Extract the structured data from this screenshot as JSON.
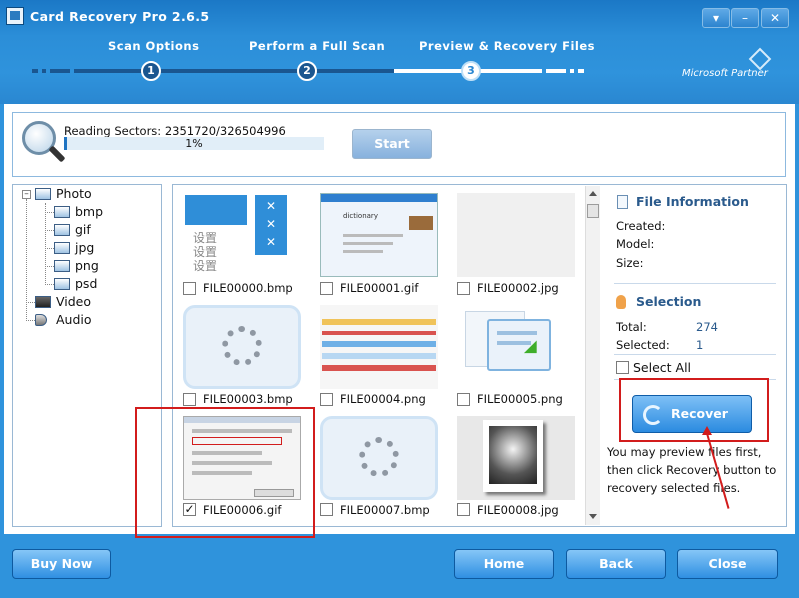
{
  "window": {
    "title": "Card Recovery Pro 2.6.5",
    "menu_glyph": "▾",
    "minimize_glyph": "–",
    "close_glyph": "✕"
  },
  "steps": [
    {
      "label": "Scan Options",
      "number": "1"
    },
    {
      "label": "Perform a Full Scan",
      "number": "2"
    },
    {
      "label": "Preview & Recovery Files",
      "number": "3"
    }
  ],
  "partner": {
    "text": "Microsoft Partner"
  },
  "status": {
    "reading": "Reading Sectors: 2351720/326504996",
    "progress_percent": 1,
    "progress_text": "1%",
    "start_label": "Start"
  },
  "tree": {
    "root": "Photo",
    "children": [
      "bmp",
      "gif",
      "jpg",
      "png",
      "psd"
    ],
    "others": [
      "Video",
      "Audio"
    ]
  },
  "files": [
    {
      "name": "FILE00000.bmp",
      "checked": false
    },
    {
      "name": "FILE00001.gif",
      "checked": false
    },
    {
      "name": "FILE00002.jpg",
      "checked": false
    },
    {
      "name": "FILE00003.bmp",
      "checked": false
    },
    {
      "name": "FILE00004.png",
      "checked": false
    },
    {
      "name": "FILE00005.png",
      "checked": false
    },
    {
      "name": "FILE00006.gif",
      "checked": true
    },
    {
      "name": "FILE00007.bmp",
      "checked": false
    },
    {
      "name": "FILE00008.jpg",
      "checked": false
    }
  ],
  "thumb_text": {
    "cn_lines": [
      "设置",
      "设置",
      "设置"
    ],
    "cn_glyph": "✕",
    "doc_title": "dictionary"
  },
  "file_info": {
    "heading": "File Information",
    "created_label": "Created:",
    "model_label": "Model:",
    "size_label": "Size:"
  },
  "selection": {
    "heading": "Selection",
    "total_label": "Total:",
    "total_value": "274",
    "selected_label": "Selected:",
    "selected_value": "1",
    "select_all_label": "Select All"
  },
  "recover": {
    "label": "Recover"
  },
  "hint": "You may preview files first, then click Recovery button to recovery selected files.",
  "bottom": {
    "buy_now": "Buy Now",
    "home": "Home",
    "back": "Back",
    "close": "Close"
  },
  "colors": {
    "header_blue": "#2f93dc",
    "accent_dark": "#1a5690",
    "annotation_red": "#d21c1c",
    "label_blue": "#2a5a8c"
  }
}
